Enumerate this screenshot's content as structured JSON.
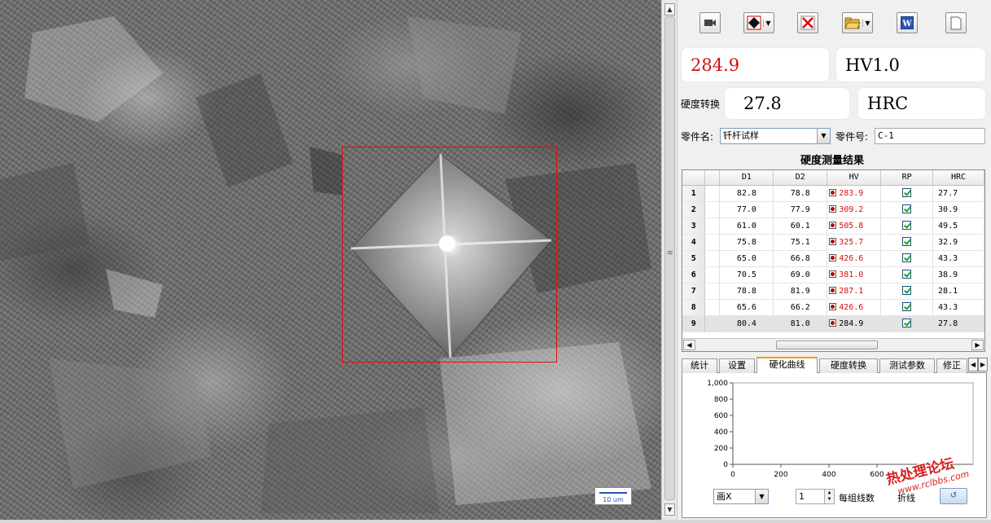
{
  "toolbar": {
    "camera_icon": "video-camera-icon",
    "measure_icon": "measure-diamond-icon",
    "delete_icon": "delete-x-icon",
    "open_icon": "open-folder-icon",
    "word_icon": "word-export-icon",
    "new_icon": "blank-page-icon"
  },
  "readout": {
    "hardness_value": "284.9",
    "hardness_scale": "HV1.0",
    "convert_label": "硬度转换",
    "converted_value": "27.8",
    "converted_scale": "HRC"
  },
  "part": {
    "name_label": "零件名:",
    "name_value": "钎杆试样",
    "number_label": "零件号:",
    "number_value": "C-1"
  },
  "results": {
    "title": "硬度测量结果",
    "columns": [
      "D1",
      "D2",
      "HV",
      "RP",
      "HRC"
    ],
    "rows": [
      {
        "n": "1",
        "d1": "82.8",
        "d2": "78.8",
        "hv": "283.9",
        "hrc": "27.7",
        "red": true
      },
      {
        "n": "2",
        "d1": "77.0",
        "d2": "77.9",
        "hv": "309.2",
        "hrc": "30.9",
        "red": true
      },
      {
        "n": "3",
        "d1": "61.0",
        "d2": "60.1",
        "hv": "505.8",
        "hrc": "49.5",
        "red": true
      },
      {
        "n": "4",
        "d1": "75.8",
        "d2": "75.1",
        "hv": "325.7",
        "hrc": "32.9",
        "red": true
      },
      {
        "n": "5",
        "d1": "65.0",
        "d2": "66.8",
        "hv": "426.6",
        "hrc": "43.3",
        "red": true
      },
      {
        "n": "6",
        "d1": "70.5",
        "d2": "69.0",
        "hv": "381.0",
        "hrc": "38.9",
        "red": true
      },
      {
        "n": "7",
        "d1": "78.8",
        "d2": "81.9",
        "hv": "287.1",
        "hrc": "28.1",
        "red": true
      },
      {
        "n": "8",
        "d1": "65.6",
        "d2": "66.2",
        "hv": "426.6",
        "hrc": "43.3",
        "red": true
      },
      {
        "n": "9",
        "d1": "80.4",
        "d2": "81.0",
        "hv": "284.9",
        "hrc": "27.8",
        "red": false
      }
    ]
  },
  "tabs": [
    {
      "label": "统计",
      "active": false
    },
    {
      "label": "设置",
      "active": false
    },
    {
      "label": "硬化曲线",
      "active": true
    },
    {
      "label": "硬度转换",
      "active": false
    },
    {
      "label": "测试参数",
      "active": false
    },
    {
      "label": "修正",
      "active": false
    }
  ],
  "chart_data": {
    "type": "line",
    "title": "",
    "xlabel": "",
    "ylabel": "",
    "xlim": [
      0,
      1000
    ],
    "ylim": [
      0,
      1000
    ],
    "x_ticks": [
      0,
      200,
      400,
      600
    ],
    "y_ticks": [
      "0",
      "200",
      "400",
      "600",
      "800",
      "1,000"
    ],
    "series": []
  },
  "controls": {
    "draw_mode_value": "画X",
    "spin_value": "1",
    "lines_per_group_label": "每组线数",
    "polyline_label": "折线"
  },
  "micrograph": {
    "scale_label": "10 um"
  },
  "watermark": {
    "main": "热处理论坛",
    "url": "www.rclbbs.com"
  },
  "colors": {
    "accent_red": "#e01010",
    "hv_red": "#d21010",
    "check_green": "#21a121",
    "tab_accent": "#f0a000"
  }
}
